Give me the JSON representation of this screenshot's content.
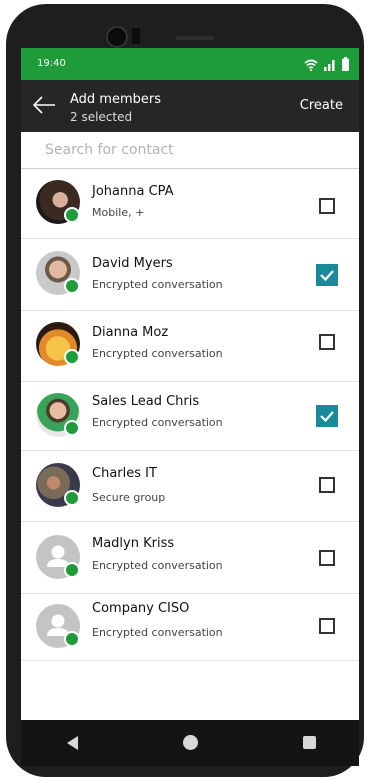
{
  "status_bar": {
    "time": "19:40"
  },
  "header": {
    "title": "Add members",
    "subtitle": "2 selected",
    "create_label": "Create"
  },
  "search": {
    "placeholder": "Search for contact"
  },
  "contacts": [
    {
      "name": "Johanna CPA",
      "detail": "Mobile, +",
      "selected": false,
      "avatar": "photo"
    },
    {
      "name": "David Myers",
      "detail": "Encrypted conversation",
      "selected": true,
      "avatar": "photo"
    },
    {
      "name": "Dianna Moz",
      "detail": "Encrypted conversation",
      "selected": false,
      "avatar": "photo"
    },
    {
      "name": "Sales Lead Chris",
      "detail": "Encrypted conversation",
      "selected": true,
      "avatar": "photo"
    },
    {
      "name": "Charles IT",
      "detail": "Secure group",
      "selected": false,
      "avatar": "photo"
    },
    {
      "name": "Madlyn Kriss",
      "detail": "Encrypted conversation",
      "selected": false,
      "avatar": "placeholder"
    },
    {
      "name": "Company CISO",
      "detail": "Encrypted conversation",
      "selected": false,
      "avatar": "placeholder"
    }
  ],
  "colors": {
    "accent_green": "#1f9c3a",
    "checkbox_teal": "#1a8a9a",
    "app_bar": "#262626"
  }
}
